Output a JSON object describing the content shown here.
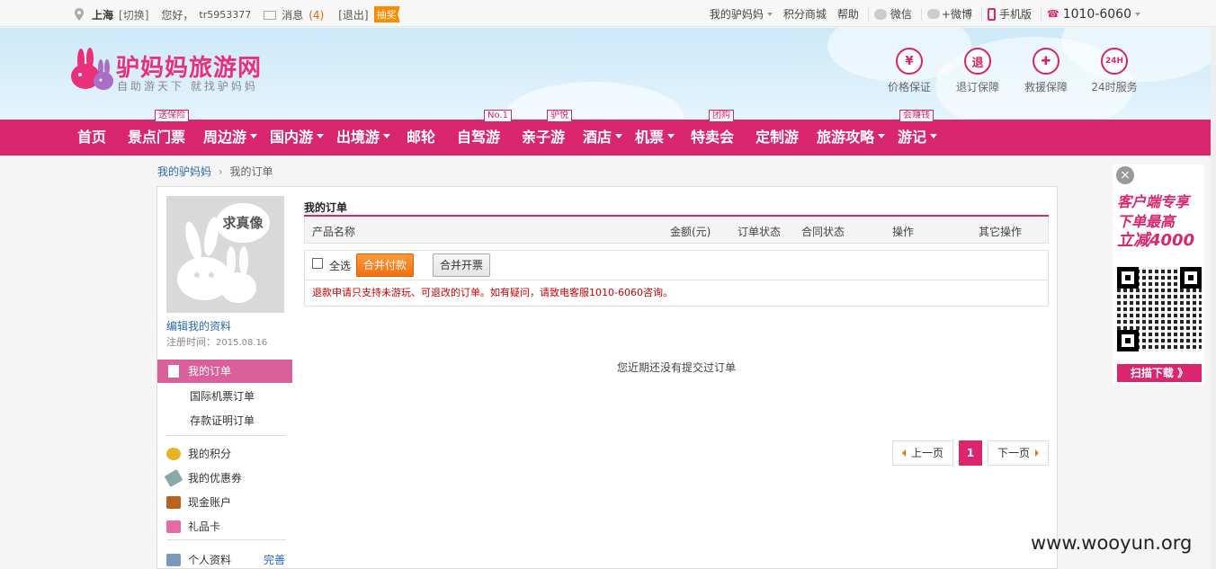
{
  "topbar": {
    "city": "上海",
    "switch": "[切换]",
    "greeting": "您好，",
    "username": "tr5953377",
    "messages_label": "消息",
    "messages_count": "(4)",
    "logout": "[退出]",
    "lottery": "抽奖",
    "my_account": "我的驴妈妈",
    "points_mall": "积分商城",
    "help": "帮助",
    "wechat": "微信",
    "weibo": "+微博",
    "mobile": "手机版",
    "phone": "1010-6060"
  },
  "header": {
    "logo_title": "驴妈妈旅游网",
    "logo_sub": "自助游天下 就找驴妈妈",
    "guarantees": [
      {
        "label": "价格保证",
        "glyph": "¥",
        "icon": "price-icon"
      },
      {
        "label": "退订保障",
        "glyph": "退",
        "icon": "refund-icon"
      },
      {
        "label": "救援保障",
        "glyph": "✚",
        "icon": "rescue-icon"
      },
      {
        "label": "24时服务",
        "glyph": "24H",
        "icon": "service-24h-icon"
      }
    ]
  },
  "nav": {
    "items": [
      {
        "label": "首页",
        "tag": ""
      },
      {
        "label": "景点门票",
        "tag": "送保险"
      },
      {
        "label": "周边游",
        "tag": ""
      },
      {
        "label": "国内游",
        "tag": ""
      },
      {
        "label": "出境游",
        "tag": ""
      },
      {
        "label": "邮轮",
        "tag": ""
      },
      {
        "label": "自驾游",
        "tag": "No.1"
      },
      {
        "label": "亲子游",
        "tag": "驴悦"
      },
      {
        "label": "酒店",
        "tag": ""
      },
      {
        "label": "机票",
        "tag": ""
      },
      {
        "label": "特卖会",
        "tag": "团购"
      },
      {
        "label": "定制游",
        "tag": ""
      },
      {
        "label": "旅游攻略",
        "tag": ""
      },
      {
        "label": "游记",
        "tag": "会赚钱"
      }
    ]
  },
  "breadcrumb": {
    "home": "我的驴妈妈",
    "current": "我的订单"
  },
  "sidebar": {
    "avatar_text": "求真像",
    "edit_profile": "编辑我的资料",
    "reg_label": "注册时间：",
    "reg_date": "2015.08.16",
    "active": "我的订单",
    "sub_items": [
      "国际机票订单",
      "存款证明订单"
    ],
    "items": [
      "我的积分",
      "我的优惠券",
      "现金账户",
      "礼品卡"
    ],
    "profile": "个人资料",
    "complete": "完善"
  },
  "orders": {
    "title": "我的订单",
    "columns": [
      "产品名称",
      "金额(元)",
      "订单状态",
      "合同状态",
      "操作",
      "其它操作"
    ],
    "select_all": "全选",
    "merge_pay": "合并付款",
    "merge_invoice": "合并开票",
    "notice": "退款申请只支持未游玩、可退改的订单。如有疑问，请致电客服1010-6060咨询。",
    "empty": "您近期还没有提交过订单",
    "prev": "上一页",
    "page": "1",
    "next": "下一页"
  },
  "promo": {
    "close": "×",
    "line1": "客户端专享",
    "line2": "下单最高",
    "line3": "立减4000",
    "scan": "扫描下载 》"
  },
  "watermark": "www.wooyun.org",
  "colors": {
    "brand": "#d9266f",
    "orange": "#f07012",
    "link": "#2a6ab3"
  }
}
